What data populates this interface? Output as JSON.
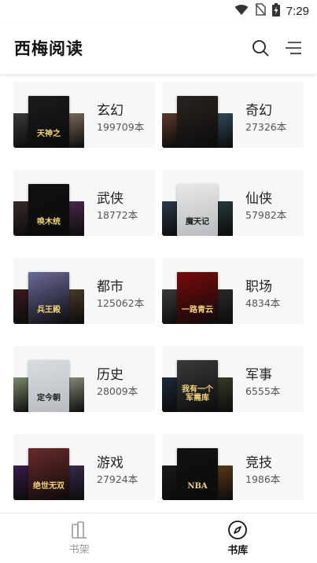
{
  "status_bar": {
    "time": "7:29"
  },
  "header": {
    "title": "西梅阅读"
  },
  "categories": [
    {
      "name": "玄幻",
      "count": "199709本",
      "cover_text": "天神之",
      "cover_colors": [
        "#3b3b3b",
        "#1c1c1c",
        "#7a6a5a"
      ]
    },
    {
      "name": "奇幻",
      "count": "27326本",
      "cover_text": "",
      "cover_colors": [
        "#5a3a2a",
        "#2a2420",
        "#2f4a5a"
      ]
    },
    {
      "name": "武侠",
      "count": "18772本",
      "cover_text": "唤木统",
      "cover_colors": [
        "#3a2a2a",
        "#111111",
        "#4a2a4a"
      ]
    },
    {
      "name": "仙侠",
      "count": "57982本",
      "cover_text": "魔天记",
      "cover_colors": [
        "#2a3a4a",
        "#e8e8e6",
        "#2a3a3a"
      ]
    },
    {
      "name": "都市",
      "count": "125062本",
      "cover_text": "兵王殿",
      "cover_colors": [
        "#3a1a1a",
        "#6a6a9a",
        "#4a3a2a"
      ]
    },
    {
      "name": "职场",
      "count": "4834本",
      "cover_text": "一路青云",
      "cover_colors": [
        "#3a3a3a",
        "#7a0a0a",
        "#2a2a2a"
      ]
    },
    {
      "name": "历史",
      "count": "28009本",
      "cover_text": "定今朝",
      "cover_colors": [
        "#7a8a6a",
        "#d6dde0",
        "#8a8a7a"
      ]
    },
    {
      "name": "军事",
      "count": "6555本",
      "cover_text": "我有一个军需库",
      "cover_colors": [
        "#1a2a3a",
        "#3a3a3a",
        "#3a3a2a"
      ]
    },
    {
      "name": "游戏",
      "count": "27924本",
      "cover_text": "绝世无双",
      "cover_colors": [
        "#3a1a4a",
        "#6a2a2a",
        "#3a2a4a"
      ]
    },
    {
      "name": "竞技",
      "count": "1986本",
      "cover_text": "NBA",
      "cover_colors": [
        "#1a1a1a",
        "#111111",
        "#5a3a1a"
      ]
    }
  ],
  "bottom_nav": {
    "tabs": [
      {
        "label": "书架",
        "icon": "bookshelf-icon",
        "active": false
      },
      {
        "label": "书库",
        "icon": "compass-icon",
        "active": true
      }
    ]
  }
}
